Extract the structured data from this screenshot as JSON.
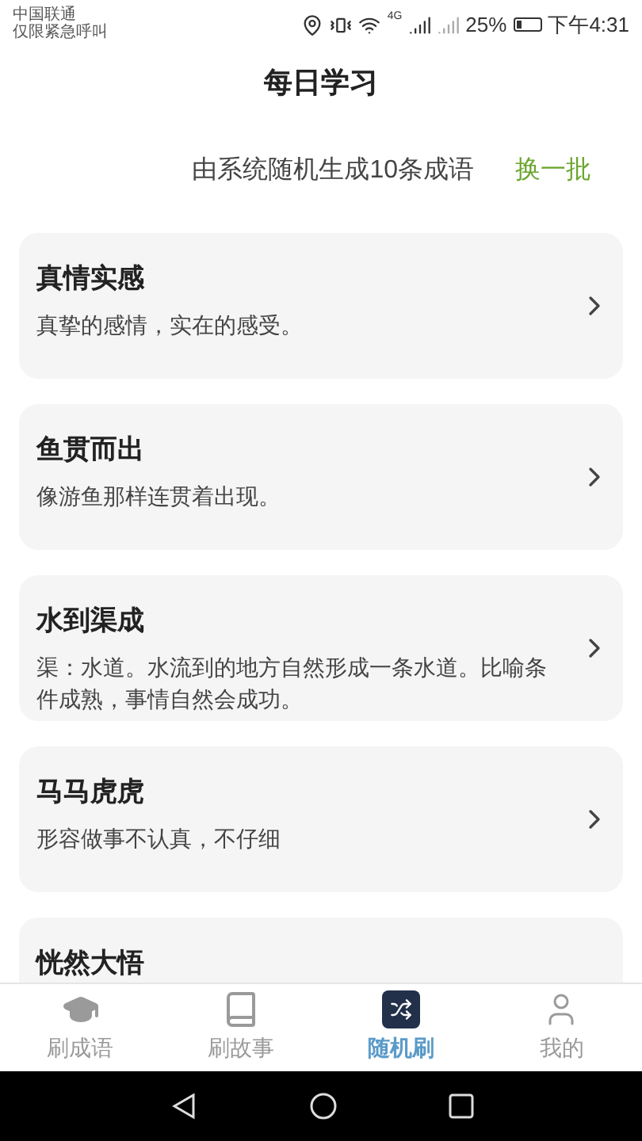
{
  "status_bar": {
    "carrier": "中国联通",
    "carrier_note": "仅限紧急呼叫",
    "network": "4G",
    "battery": "25%",
    "time": "下午4:31"
  },
  "title": "每日学习",
  "subtitle": "由系统随机生成10条成语",
  "refresh": "换一批",
  "idioms": [
    {
      "name": "真情实感",
      "meaning": "真挚的感情，实在的感受。"
    },
    {
      "name": "鱼贯而出",
      "meaning": "像游鱼那样连贯着出现。"
    },
    {
      "name": "水到渠成",
      "meaning": "渠：水道。水流到的地方自然形成一条水道。比喻条件成熟，事情自然会成功。"
    },
    {
      "name": "马马虎虎",
      "meaning": "形容做事不认真，不仔细"
    },
    {
      "name": "恍然大悟"
    }
  ],
  "tabs": [
    {
      "kind": "cap",
      "label": "刷成语",
      "selected": false
    },
    {
      "kind": "book",
      "label": "刷故事",
      "selected": false
    },
    {
      "kind": "shuffle",
      "label": "随机刷",
      "selected": true
    },
    {
      "kind": "user",
      "label": "我的",
      "selected": false
    }
  ]
}
